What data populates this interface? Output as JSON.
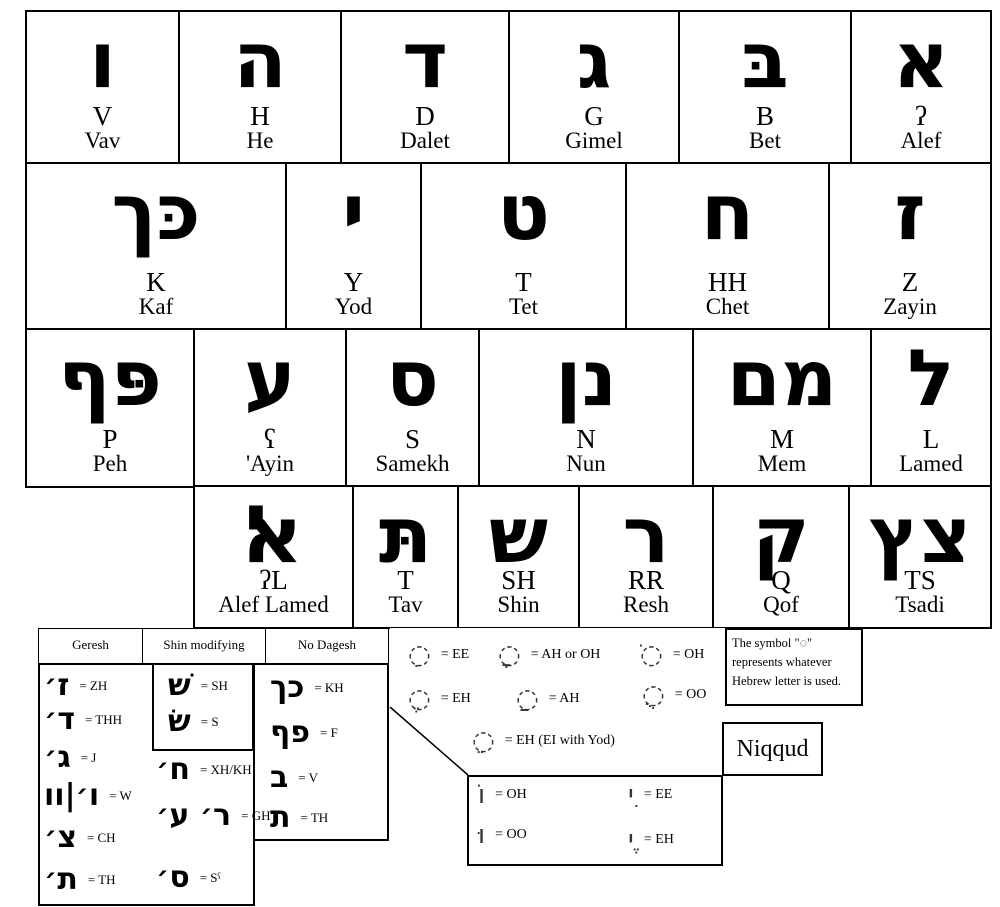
{
  "letters": [
    [
      {
        "heb": "ו",
        "tr": "V",
        "name": "Vav"
      },
      {
        "heb": "ה",
        "tr": "H",
        "name": "He"
      },
      {
        "heb": "ד",
        "tr": "D",
        "name": "Dalet"
      },
      {
        "heb": "ג",
        "tr": "G",
        "name": "Gimel"
      },
      {
        "heb": "בּ",
        "tr": "B",
        "name": "Bet"
      },
      {
        "heb": "א",
        "tr": "ʔ",
        "name": "Alef"
      }
    ],
    [
      {
        "heb": "כּך",
        "tr": "K",
        "name": "Kaf"
      },
      {
        "heb": "י",
        "tr": "Y",
        "name": "Yod"
      },
      {
        "heb": "ט",
        "tr": "T",
        "name": "Tet"
      },
      {
        "heb": "ח",
        "tr": "HH",
        "name": "Chet"
      },
      {
        "heb": "ז",
        "tr": "Z",
        "name": "Zayin"
      }
    ],
    [
      {
        "heb": "פּף",
        "tr": "P",
        "name": "Peh"
      },
      {
        "heb": "ע",
        "tr": "ʕ",
        "name": "'Ayin"
      },
      {
        "heb": "ס",
        "tr": "S",
        "name": "Samekh"
      },
      {
        "heb": "נן",
        "tr": "N",
        "name": "Nun"
      },
      {
        "heb": "מם",
        "tr": "M",
        "name": "Mem"
      },
      {
        "heb": "ל",
        "tr": "L",
        "name": "Lamed"
      }
    ],
    [
      {
        "heb": "ﭏ",
        "tr": "ʔL",
        "name": "Alef Lamed"
      },
      {
        "heb": "תּ",
        "tr": "T",
        "name": "Tav"
      },
      {
        "heb": "ש",
        "tr": "SH",
        "name": "Shin"
      },
      {
        "heb": "ר",
        "tr": "RR",
        "name": "Resh"
      },
      {
        "heb": "ק",
        "tr": "Q",
        "name": "Qof"
      },
      {
        "heb": "צץ",
        "tr": "TS",
        "name": "Tsadi"
      }
    ]
  ],
  "headers": {
    "geresh": "Geresh",
    "shin": "Shin modifying",
    "nodagesh": "No Dagesh"
  },
  "geresh": [
    {
      "g": "ז׳",
      "v": "= ZH"
    },
    {
      "g": "ד׳",
      "v": "= THH"
    },
    {
      "g": "ג׳",
      "v": "= J"
    },
    {
      "g": "ו׳|וו",
      "v": "= W"
    },
    {
      "g": "צ׳",
      "v": "= CH"
    },
    {
      "g": "ת׳",
      "v": "= TH"
    }
  ],
  "geresh2": [
    {
      "g": "ח׳",
      "v": "= XH/KH"
    },
    {
      "g": "ר׳ ע׳",
      "v": "= GH"
    },
    {
      "g": "ס׳",
      "v": "= Sˤ"
    }
  ],
  "shin": [
    {
      "g": "שׁ",
      "v": "= SH"
    },
    {
      "g": "שׂ",
      "v": "= S"
    }
  ],
  "nodagesh": [
    {
      "g": "כך",
      "v": "= KH"
    },
    {
      "g": "פף",
      "v": "= F"
    },
    {
      "g": "ב",
      "v": "= V"
    },
    {
      "g": "ת",
      "v": "= TH"
    }
  ],
  "niqqud": [
    {
      "g": "◌ִ",
      "v": "= EE"
    },
    {
      "g": "◌ָ",
      "v": "= AH or OH"
    },
    {
      "g": "◌ֹ",
      "v": "= OH"
    },
    {
      "g": "◌ֶ",
      "v": "= EH"
    },
    {
      "g": "◌ַ",
      "v": "= AH"
    },
    {
      "g": "◌ֻ",
      "v": "= OO"
    },
    {
      "g": "◌ֵ",
      "v": "= EH (EI with Yod)"
    }
  ],
  "vavyod": [
    {
      "g": "וֹ",
      "v": "= OH"
    },
    {
      "g": "ִי",
      "v": "= EE"
    },
    {
      "g": "וּ",
      "v": "= OO"
    },
    {
      "g": "ֶי",
      "v": "= EH"
    }
  ],
  "note": {
    "l1": "The symbol \"◌\"",
    "l2": "represents whatever",
    "l3": "Hebrew letter is used."
  },
  "niqqud_label": "Niqqud"
}
